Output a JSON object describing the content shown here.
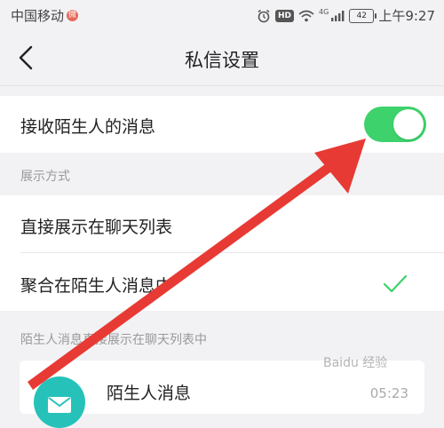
{
  "status_bar": {
    "carrier": "中国移动",
    "carrier_badge": "微",
    "hd": "HD",
    "network": "4G",
    "battery": "42",
    "time": "上午9:27"
  },
  "nav": {
    "title": "私信设置"
  },
  "settings": {
    "receive_stranger_messages": {
      "label": "接收陌生人的消息",
      "enabled": true
    },
    "display_section_label": "展示方式",
    "options": [
      {
        "label": "直接展示在聊天列表",
        "selected": false
      },
      {
        "label": "聚合在陌生人消息中",
        "selected": true
      }
    ],
    "preview_section_label": "陌生人消息直接展示在聊天列表中"
  },
  "preview": {
    "title": "陌生人消息",
    "time": "05:23"
  },
  "watermark": "Baidu 经验",
  "colors": {
    "toggle_on": "#3dd26b",
    "checkmark": "#3dd26b",
    "avatar": "#26c2ba",
    "arrow": "#e83a34"
  }
}
